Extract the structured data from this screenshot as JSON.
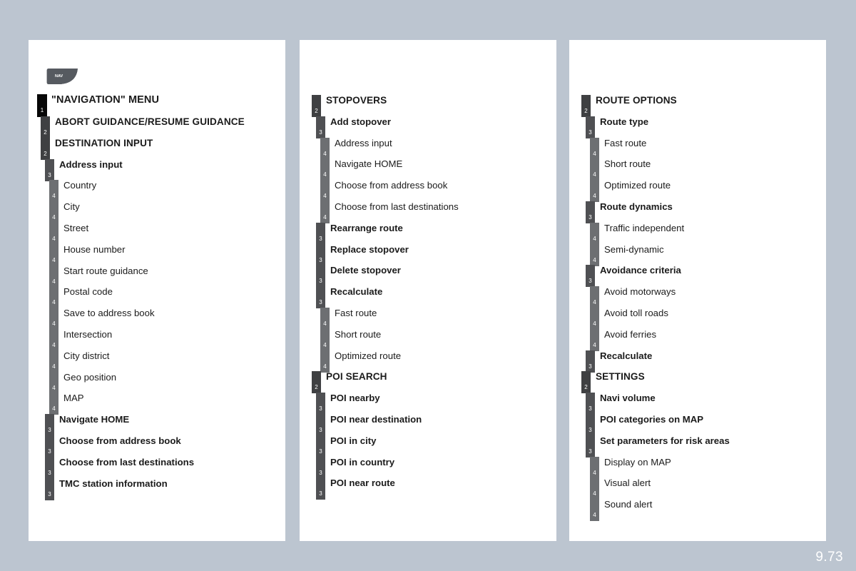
{
  "page": {
    "number": "9.73",
    "background_color": "#bcc5d0",
    "card_color": "#ffffff"
  },
  "nav_icon": {
    "name": "nav-button-icon",
    "label": "NAV",
    "color": "#565a60"
  },
  "levels": {
    "1": {
      "badge": "1",
      "color": "#070707"
    },
    "2": {
      "badge": "2",
      "color": "#3f4042"
    },
    "3": {
      "badge": "3",
      "color": "#4f5053"
    },
    "4": {
      "badge": "4",
      "color": "#6d6f72"
    }
  },
  "columns": [
    {
      "id": "column-1",
      "items": [
        {
          "level": 1,
          "badge": "1",
          "label": "\"NAVIGATION\" MENU"
        },
        {
          "level": 2,
          "badge": "2",
          "label": "ABORT GUIDANCE/RESUME GUIDANCE"
        },
        {
          "level": 2,
          "badge": "2",
          "label": "DESTINATION INPUT"
        },
        {
          "level": 3,
          "badge": "3",
          "label": "Address input"
        },
        {
          "level": 4,
          "badge": "4",
          "label": "Country"
        },
        {
          "level": 4,
          "badge": "4",
          "label": "City"
        },
        {
          "level": 4,
          "badge": "4",
          "label": "Street"
        },
        {
          "level": 4,
          "badge": "4",
          "label": "House number"
        },
        {
          "level": 4,
          "badge": "4",
          "label": "Start route guidance"
        },
        {
          "level": 4,
          "badge": "4",
          "label": "Postal code"
        },
        {
          "level": 4,
          "badge": "4",
          "label": "Save to address book"
        },
        {
          "level": 4,
          "badge": "4",
          "label": "Intersection"
        },
        {
          "level": 4,
          "badge": "4",
          "label": "City district"
        },
        {
          "level": 4,
          "badge": "4",
          "label": "Geo position"
        },
        {
          "level": 4,
          "badge": "4",
          "label": "MAP"
        },
        {
          "level": 3,
          "badge": "3",
          "label": "Navigate HOME"
        },
        {
          "level": 3,
          "badge": "3",
          "label": "Choose from address book"
        },
        {
          "level": 3,
          "badge": "3",
          "label": "Choose from last destinations"
        },
        {
          "level": 3,
          "badge": "3",
          "label": "TMC station information"
        }
      ]
    },
    {
      "id": "column-2",
      "items": [
        {
          "level": 2,
          "badge": "2",
          "label": "STOPOVERS"
        },
        {
          "level": 3,
          "badge": "3",
          "label": "Add stopover"
        },
        {
          "level": 4,
          "badge": "4",
          "label": "Address input"
        },
        {
          "level": 4,
          "badge": "4",
          "label": "Navigate HOME"
        },
        {
          "level": 4,
          "badge": "4",
          "label": "Choose from address book"
        },
        {
          "level": 4,
          "badge": "4",
          "label": "Choose from last destinations"
        },
        {
          "level": 3,
          "badge": "3",
          "label": "Rearrange route"
        },
        {
          "level": 3,
          "badge": "3",
          "label": "Replace stopover"
        },
        {
          "level": 3,
          "badge": "3",
          "label": "Delete stopover"
        },
        {
          "level": 3,
          "badge": "3",
          "label": "Recalculate"
        },
        {
          "level": 4,
          "badge": "4",
          "label": "Fast route"
        },
        {
          "level": 4,
          "badge": "4",
          "label": "Short route"
        },
        {
          "level": 4,
          "badge": "4",
          "label": "Optimized route"
        },
        {
          "level": 2,
          "badge": "2",
          "label": "POI SEARCH"
        },
        {
          "level": 3,
          "badge": "3",
          "label": "POI nearby"
        },
        {
          "level": 3,
          "badge": "3",
          "label": "POI near destination"
        },
        {
          "level": 3,
          "badge": "3",
          "label": "POI in city"
        },
        {
          "level": 3,
          "badge": "3",
          "label": "POI in country"
        },
        {
          "level": 3,
          "badge": "3",
          "label": "POI near route"
        }
      ]
    },
    {
      "id": "column-3",
      "items": [
        {
          "level": 2,
          "badge": "2",
          "label": "ROUTE OPTIONS"
        },
        {
          "level": 3,
          "badge": "3",
          "label": "Route type"
        },
        {
          "level": 4,
          "badge": "4",
          "label": "Fast route"
        },
        {
          "level": 4,
          "badge": "4",
          "label": "Short route"
        },
        {
          "level": 4,
          "badge": "4",
          "label": "Optimized route"
        },
        {
          "level": 3,
          "badge": "3",
          "label": "Route dynamics"
        },
        {
          "level": 4,
          "badge": "4",
          "label": "Traffic independent"
        },
        {
          "level": 4,
          "badge": "4",
          "label": "Semi-dynamic"
        },
        {
          "level": 3,
          "badge": "3",
          "label": "Avoidance criteria"
        },
        {
          "level": 4,
          "badge": "4",
          "label": "Avoid motorways"
        },
        {
          "level": 4,
          "badge": "4",
          "label": "Avoid toll roads"
        },
        {
          "level": 4,
          "badge": "4",
          "label": "Avoid ferries"
        },
        {
          "level": 3,
          "badge": "3",
          "label": "Recalculate"
        },
        {
          "level": 2,
          "badge": "2",
          "label": "SETTINGS"
        },
        {
          "level": 3,
          "badge": "3",
          "label": "Navi volume"
        },
        {
          "level": 3,
          "badge": "3",
          "label": "POI categories on MAP"
        },
        {
          "level": 3,
          "badge": "3",
          "label": "Set parameters for risk areas"
        },
        {
          "level": 4,
          "badge": "4",
          "label": "Display on MAP"
        },
        {
          "level": 4,
          "badge": "4",
          "label": "Visual alert"
        },
        {
          "level": 4,
          "badge": "4",
          "label": "Sound alert"
        }
      ]
    }
  ]
}
